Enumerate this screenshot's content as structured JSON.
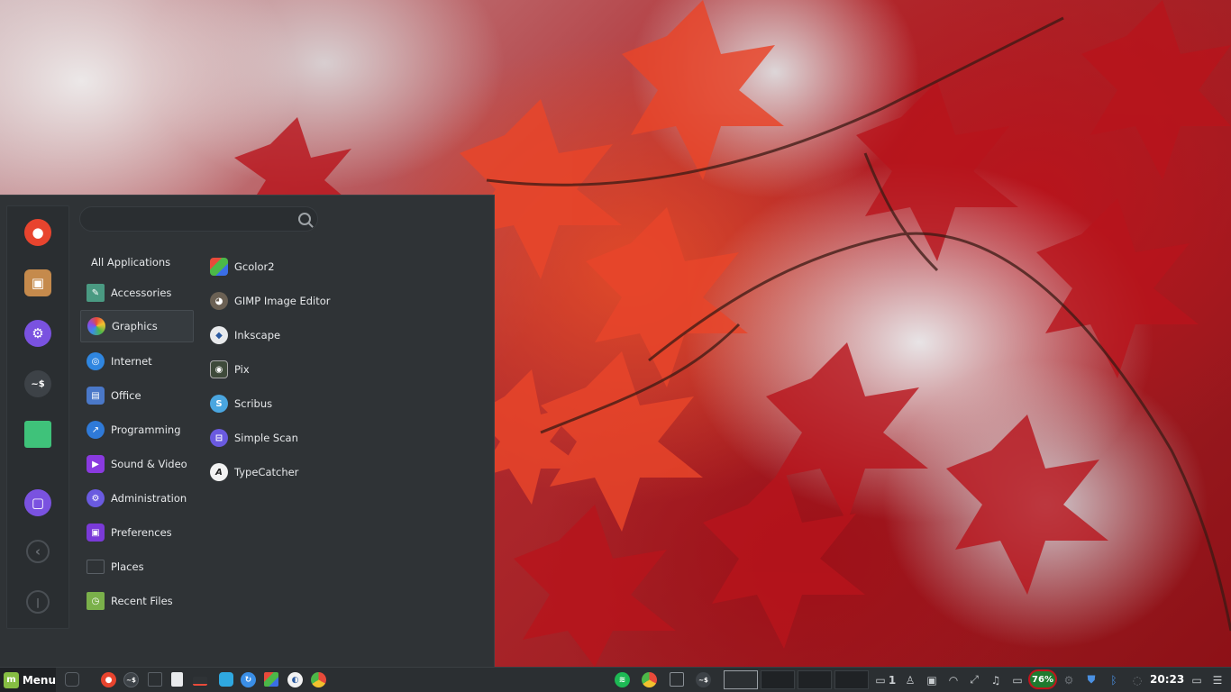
{
  "colors": {
    "menu_bg": "#2f3336",
    "taskbar_bg": "#2b2f32",
    "accent": "#86be43",
    "battery_ring": "#c0141c"
  },
  "search": {
    "placeholder": ""
  },
  "favorites": [
    {
      "name": "firefox",
      "icon": "firefox-icon",
      "color": "#e8442e"
    },
    {
      "name": "software-manager",
      "icon": "package-icon",
      "color": "#c58a4c"
    },
    {
      "name": "system-settings",
      "icon": "gear-icon",
      "color": "#7a52e0"
    },
    {
      "name": "terminal",
      "icon": "terminal-icon",
      "color": "#3d4247"
    },
    {
      "name": "files",
      "icon": "folder-icon",
      "color": "#3fc27a"
    },
    {
      "name": "lock-screen",
      "icon": "lock-icon",
      "color": "#7a52e0"
    },
    {
      "name": "logout",
      "icon": "logout-icon",
      "color": "#3a3f43"
    },
    {
      "name": "quit",
      "icon": "power-icon",
      "color": "#3a3f43"
    }
  ],
  "categories": [
    {
      "label": "All Applications",
      "icon": ""
    },
    {
      "label": "Accessories",
      "icon": "accessories-icon"
    },
    {
      "label": "Graphics",
      "icon": "graphics-icon"
    },
    {
      "label": "Internet",
      "icon": "internet-icon"
    },
    {
      "label": "Office",
      "icon": "office-icon"
    },
    {
      "label": "Programming",
      "icon": "programming-icon"
    },
    {
      "label": "Sound & Video",
      "icon": "sound-video-icon"
    },
    {
      "label": "Administration",
      "icon": "administration-icon"
    },
    {
      "label": "Preferences",
      "icon": "preferences-icon"
    },
    {
      "label": "Places",
      "icon": "places-icon"
    },
    {
      "label": "Recent Files",
      "icon": "recent-files-icon"
    }
  ],
  "selected_category": "Graphics",
  "apps": [
    {
      "label": "Gcolor2",
      "icon": "gcolor2-icon"
    },
    {
      "label": "GIMP Image Editor",
      "icon": "gimp-icon"
    },
    {
      "label": "Inkscape",
      "icon": "inkscape-icon"
    },
    {
      "label": "Pix",
      "icon": "pix-icon"
    },
    {
      "label": "Scribus",
      "icon": "scribus-icon"
    },
    {
      "label": "Simple Scan",
      "icon": "simple-scan-icon"
    },
    {
      "label": "TypeCatcher",
      "icon": "typecatcher-icon"
    }
  ],
  "taskbar": {
    "menu_label": "Menu",
    "notifications_count": "1",
    "battery_percent": "76%",
    "clock": "20:23",
    "workspaces": 4
  }
}
